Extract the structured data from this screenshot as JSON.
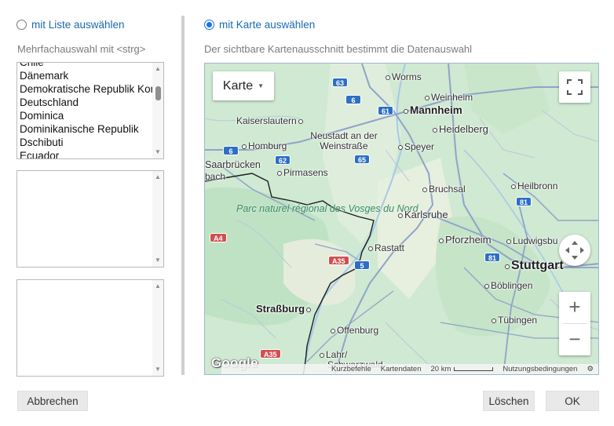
{
  "left": {
    "radio_label": "mit Liste auswählen",
    "hint": "Mehrfachauswahl mit <strg>",
    "countries": [
      "Dänemark",
      "Demokratische Republik Kongo",
      "Deutschland",
      "Dominica",
      "Dominikanische Republik",
      "Dschibuti",
      "Ecuador"
    ]
  },
  "right": {
    "radio_label": "mit Karte auswählen",
    "hint": "Der sichtbare Kartenausschnitt bestimmt die Datenauswahl"
  },
  "map": {
    "map_type": "Karte",
    "cities": {
      "worms": "Worms",
      "weinheim": "Weinheim",
      "mannheim": "Mannheim",
      "kaiserslautern": "Kaiserslautern",
      "heidelberg": "Heidelberg",
      "neustadt": "Neustadt an der Weinstraße",
      "homburg": "Homburg",
      "speyer": "Speyer",
      "saarbruecken": "Saarbrücken",
      "pirmasens": "Pirmasens",
      "bruchsal": "Bruchsal",
      "heilbronn": "Heilbronn",
      "karlsruhe": "Karlsruhe",
      "pforzheim": "Pforzheim",
      "ludwigsburg": "Ludwigsbu",
      "rastatt": "Rastatt",
      "stuttgart": "Stuttgart",
      "boeblingen": "Böblingen",
      "strassburg": "Straßburg",
      "offenburg": "Offenburg",
      "tuebingen": "Tübingen",
      "lahr": "Lahr/",
      "lahr2": "Schwarzwald",
      "bach": "bach"
    },
    "park": "Parc naturel régional des Vosges du Nord",
    "shields": {
      "a63": "63",
      "a6a": "6",
      "a61": "61",
      "a6b": "6",
      "a62": "62",
      "a65": "65",
      "a81a": "81",
      "a81b": "81",
      "a5": "5",
      "a4": "A4",
      "a35a": "A35",
      "a35b": "A35"
    },
    "logo": "Google",
    "attribution": {
      "shortcuts": "Kurzbefehle",
      "mapdata": "Kartendaten",
      "scale": "20 km",
      "terms": "Nutzungsbedingungen"
    }
  },
  "buttons": {
    "cancel": "Abbrechen",
    "clear": "Löschen",
    "ok": "OK"
  }
}
